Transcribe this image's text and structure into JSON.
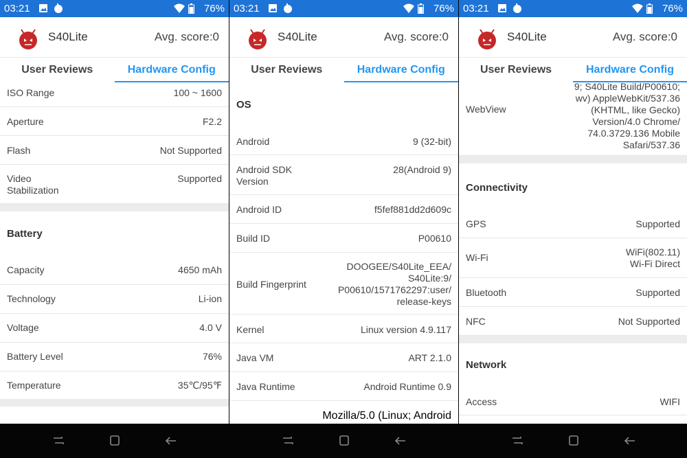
{
  "status": {
    "time": "03:21",
    "battery": "76%"
  },
  "header": {
    "app_name": "S40Lite",
    "avg_score": "Avg. score:0"
  },
  "tabs": {
    "user_reviews": "User Reviews",
    "hardware_config": "Hardware Config"
  },
  "panel1": {
    "camera_rows": [
      {
        "label": "ISO Range",
        "value": "100 ~ 1600"
      },
      {
        "label": "Aperture",
        "value": "F2.2"
      },
      {
        "label": "Flash",
        "value": "Not Supported"
      },
      {
        "label": "Video\nStabilization",
        "value": "Supported"
      }
    ],
    "battery_title": "Battery",
    "battery_rows": [
      {
        "label": "Capacity",
        "value": "4650 mAh"
      },
      {
        "label": "Technology",
        "value": "Li-ion"
      },
      {
        "label": "Voltage",
        "value": "4.0 V"
      },
      {
        "label": "Battery Level",
        "value": "76%"
      },
      {
        "label": "Temperature",
        "value": "35℃/95℉"
      }
    ]
  },
  "panel2": {
    "os_title": "OS",
    "rows": [
      {
        "label": "Android",
        "value": "9 (32-bit)"
      },
      {
        "label": "Android SDK\nVersion",
        "value": "28(Android 9)"
      },
      {
        "label": "Android ID",
        "value": "f5fef881dd2d609c"
      },
      {
        "label": "Build ID",
        "value": "P00610"
      },
      {
        "label": "Build Fingerprint",
        "value": "DOOGEE/S40Lite_EEA/\nS40Lite:9/\nP00610/1571762297:user/\nrelease-keys"
      },
      {
        "label": "Kernel",
        "value": "Linux version 4.9.117"
      },
      {
        "label": "Java VM",
        "value": "ART 2.1.0"
      },
      {
        "label": "Java Runtime",
        "value": "Android Runtime 0.9"
      }
    ],
    "partial_value": "Mozilla/5.0 (Linux; Android"
  },
  "panel3": {
    "webview": {
      "label": "WebView",
      "value": "9; S40Lite Build/P00610;\nwv) AppleWebKit/537.36\n(KHTML, like Gecko)\nVersion/4.0 Chrome/\n74.0.3729.136 Mobile\nSafari/537.36"
    },
    "connectivity_title": "Connectivity",
    "connectivity_rows": [
      {
        "label": "GPS",
        "value": "Supported"
      },
      {
        "label": "Wi-Fi",
        "value": "WiFi(802.11)\nWi-Fi Direct"
      },
      {
        "label": "Bluetooth",
        "value": "Supported"
      },
      {
        "label": "NFC",
        "value": "Not Supported"
      }
    ],
    "network_title": "Network",
    "network_rows": [
      {
        "label": "Access",
        "value": "WIFI"
      }
    ]
  },
  "icons": {
    "status": [
      "image-icon",
      "android-icon",
      "wifi-icon",
      "battery-icon"
    ],
    "nav": [
      "recents-icon",
      "home-icon",
      "back-icon"
    ],
    "logo": "antutu-logo"
  }
}
